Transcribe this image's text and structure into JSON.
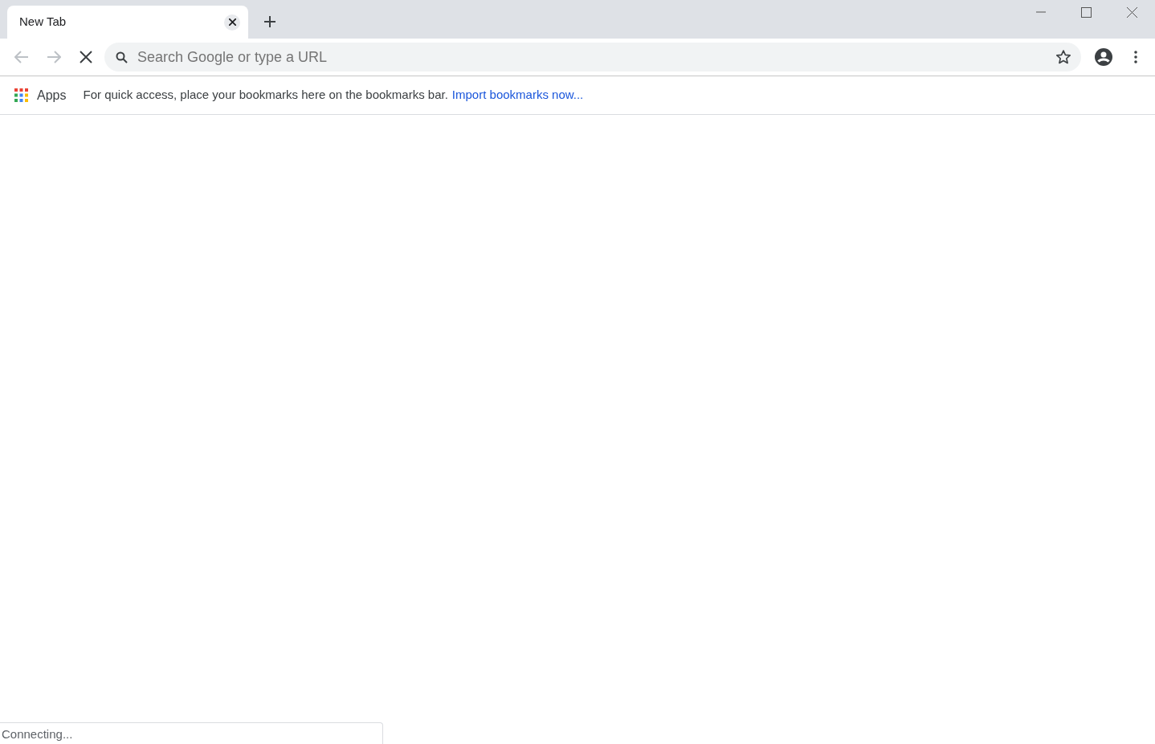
{
  "tabs": [
    {
      "title": "New Tab",
      "selected": true
    }
  ],
  "toolbar": {
    "back": {
      "disabled": true
    },
    "forward": {
      "disabled": true
    },
    "loading": true,
    "omnibox": {
      "placeholder": "Search Google or type a URL"
    }
  },
  "bookmarks_bar": {
    "apps_label": "Apps",
    "message": "For quick access, place your bookmarks here on the bookmarks bar.",
    "import_link": "Import bookmarks now..."
  },
  "status_bar": "Connecting..."
}
